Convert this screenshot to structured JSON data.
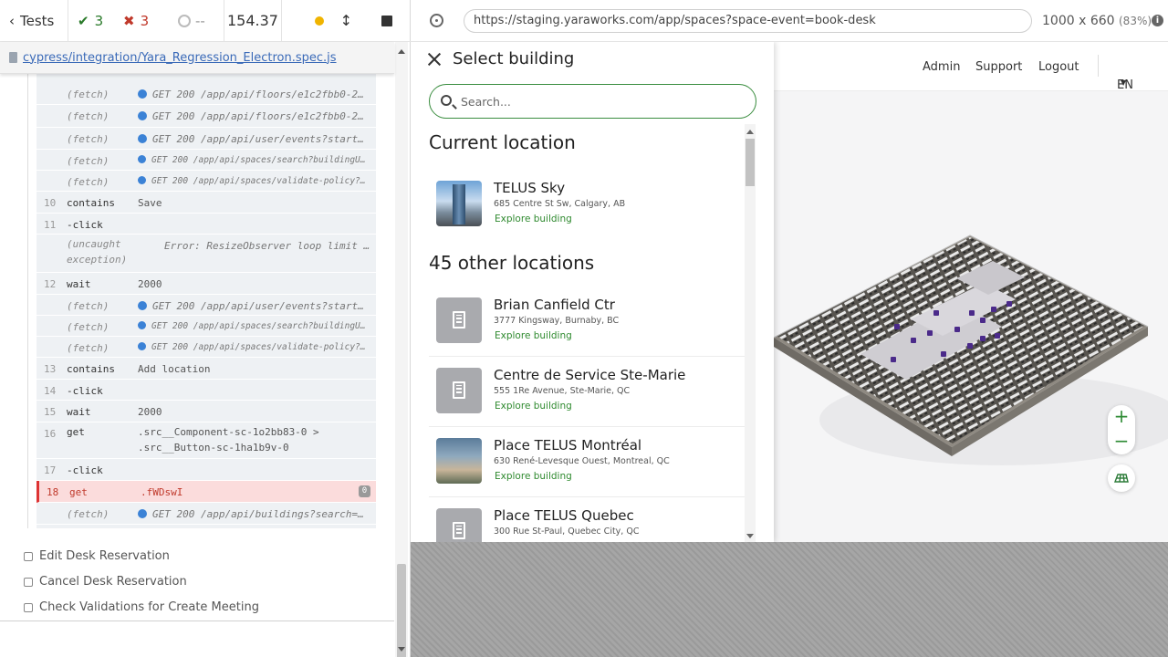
{
  "runner": {
    "tests_label": "Tests",
    "passed": "3",
    "failed": "3",
    "pending": "--",
    "duration": "154.37",
    "spec_file": "cypress/integration/Yara_Regression_Electron.spec.js",
    "commands": [
      {
        "num": "",
        "name": "(fetch)",
        "msg": "GET 200 /app/api/floors/e1c2fbb0-2…",
        "kind": "sub",
        "dot": true
      },
      {
        "num": "",
        "name": "(fetch)",
        "msg": "GET 200 /app/api/floors/e1c2fbb0-2…",
        "kind": "sub",
        "dot": true
      },
      {
        "num": "",
        "name": "(fetch)",
        "msg": "GET 200 /app/api/user/events?start…",
        "kind": "sub",
        "dot": true
      },
      {
        "num": "",
        "name": "(fetch)",
        "msg": "GET 200 /app/api/spaces/search?buildingUu…",
        "kind": "sub small",
        "dot": true
      },
      {
        "num": "",
        "name": "(fetch)",
        "msg": "GET 200 /app/api/spaces/validate-policy?s…",
        "kind": "sub small",
        "dot": true
      },
      {
        "num": "10",
        "name": "contains",
        "msg": "Save",
        "kind": "",
        "dot": false
      },
      {
        "num": "11",
        "name": " -click",
        "msg": "",
        "kind": "",
        "dot": false
      },
      {
        "num": "",
        "name": "(uncaught exception)",
        "msg": "Error: ResizeObserver loop limit …",
        "kind": "sub",
        "dot": false
      },
      {
        "num": "12",
        "name": "wait",
        "msg": "2000",
        "kind": "",
        "dot": false
      },
      {
        "num": "",
        "name": "(fetch)",
        "msg": "GET 200 /app/api/user/events?start…",
        "kind": "sub",
        "dot": true
      },
      {
        "num": "",
        "name": "(fetch)",
        "msg": "GET 200 /app/api/spaces/search?buildingUu…",
        "kind": "sub small",
        "dot": true
      },
      {
        "num": "",
        "name": "(fetch)",
        "msg": "GET 200 /app/api/spaces/validate-policy?s…",
        "kind": "sub small",
        "dot": true
      },
      {
        "num": "13",
        "name": "contains",
        "msg": "Add location",
        "kind": "",
        "dot": false
      },
      {
        "num": "14",
        "name": " -click",
        "msg": "",
        "kind": "",
        "dot": false
      },
      {
        "num": "15",
        "name": "wait",
        "msg": "2000",
        "kind": "",
        "dot": false
      },
      {
        "num": "16",
        "name": "get",
        "msg": ".src__Component-sc-1o2bb83-0 > .src__Button-sc-1ha1b9v-0",
        "kind": "",
        "dot": false
      },
      {
        "num": "17",
        "name": " -click",
        "msg": "",
        "kind": "",
        "dot": false
      },
      {
        "num": "18",
        "name": "get",
        "msg": ".fWDswI",
        "kind": "failed",
        "dot": false,
        "badge": "0"
      },
      {
        "num": "",
        "name": "(fetch)",
        "msg": "GET 200 /app/api/buildings?search=…",
        "kind": "sub",
        "dot": true
      }
    ],
    "other_tests": [
      "Edit Desk Reservation",
      "Cancel Desk Reservation",
      "Check Validations for Create Meeting"
    ]
  },
  "browser": {
    "url": "https://staging.yaraworks.com/app/spaces?space-event=book-desk",
    "viewport": "1000 x 660",
    "scale": "(83%)",
    "info": "i"
  },
  "app": {
    "nav": {
      "admin": "Admin",
      "support": "Support",
      "logout": "Logout",
      "lang": "EN"
    },
    "drawer": {
      "title": "Select building",
      "search_placeholder": "Search...",
      "current_heading": "Current location",
      "other_heading": "45 other locations",
      "explore": "Explore building",
      "current": {
        "name": "TELUS Sky",
        "address": "685 Centre St Sw, Calgary, AB"
      },
      "others": [
        {
          "name": "Brian Canfield Ctr",
          "address": "3777 Kingsway, Burnaby, BC",
          "thumb": "icon"
        },
        {
          "name": "Centre de Service Ste-Marie",
          "address": "555 1Re Avenue, Ste-Marie, QC",
          "thumb": "icon"
        },
        {
          "name": "Place TELUS Montréal",
          "address": "630 René-Levesque Ouest, Montreal, QC",
          "thumb": "photo"
        },
        {
          "name": "Place TELUS Quebec",
          "address": "300 Rue St-Paul, Quebec City, QC",
          "thumb": "icon"
        }
      ]
    },
    "zoom_in": "+",
    "zoom_out": "−",
    "colors": {
      "brand_green": "#2f8a2f",
      "fail_red": "#c0392b",
      "pin_purple": "#4b2a8a"
    }
  }
}
